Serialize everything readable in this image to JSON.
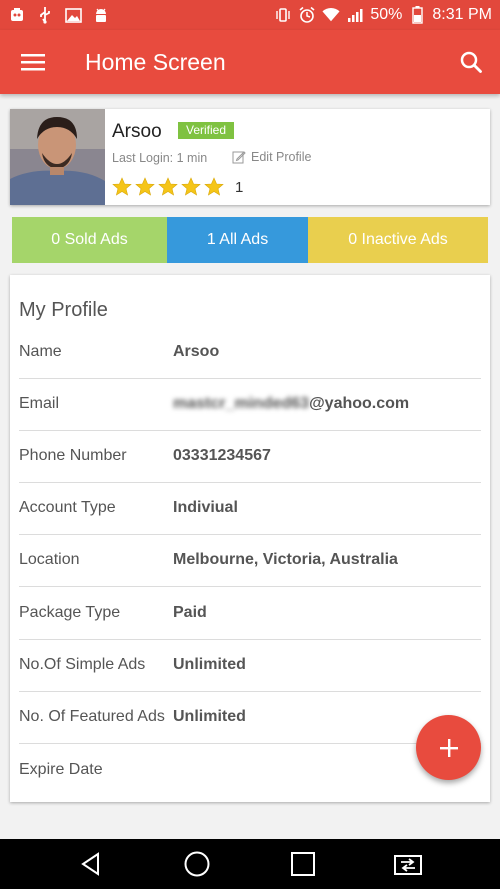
{
  "status_bar": {
    "battery": "50%",
    "time": "8:31 PM",
    "left_icons": [
      "notification-app-icon",
      "usb-icon",
      "image-icon",
      "android-icon"
    ],
    "right_icons": [
      "vibrate-icon",
      "alarm-icon",
      "wifi-icon",
      "signal-icon",
      "battery-icon"
    ]
  },
  "app_bar": {
    "title": "Home Screen"
  },
  "profile": {
    "name": "Arsoo",
    "badge": "Verified",
    "last_login": "Last Login: 1 min",
    "edit_label": "Edit Profile",
    "rating_stars": 5,
    "rating_count": "1"
  },
  "stats": {
    "sold": "0 Sold Ads",
    "all": "1 All Ads",
    "inactive": "0 Inactive Ads"
  },
  "info": {
    "title": "My Profile",
    "rows": [
      {
        "label": "Name",
        "value": "Arsoo"
      },
      {
        "label": "Email",
        "value_hidden": "mastcr_minded63",
        "value_visible": "@yahoo.com"
      },
      {
        "label": "Phone Number",
        "value": "03331234567"
      },
      {
        "label": "Account Type",
        "value": "Indiviual"
      },
      {
        "label": "Location",
        "value": "Melbourne, Victoria, Australia"
      },
      {
        "label": "Package Type",
        "value": "Paid"
      },
      {
        "label": "No.Of Simple Ads",
        "value": "Unlimited"
      },
      {
        "label": "No. Of Featured Ads",
        "value": "Unlimited"
      },
      {
        "label": "Expire Date",
        "value": ""
      }
    ]
  },
  "colors": {
    "primary": "#e84b3e",
    "sold": "#a5d56a",
    "all": "#3699dc",
    "inactive": "#e9cf4e",
    "verified": "#7fc241",
    "star": "#f5c518"
  }
}
